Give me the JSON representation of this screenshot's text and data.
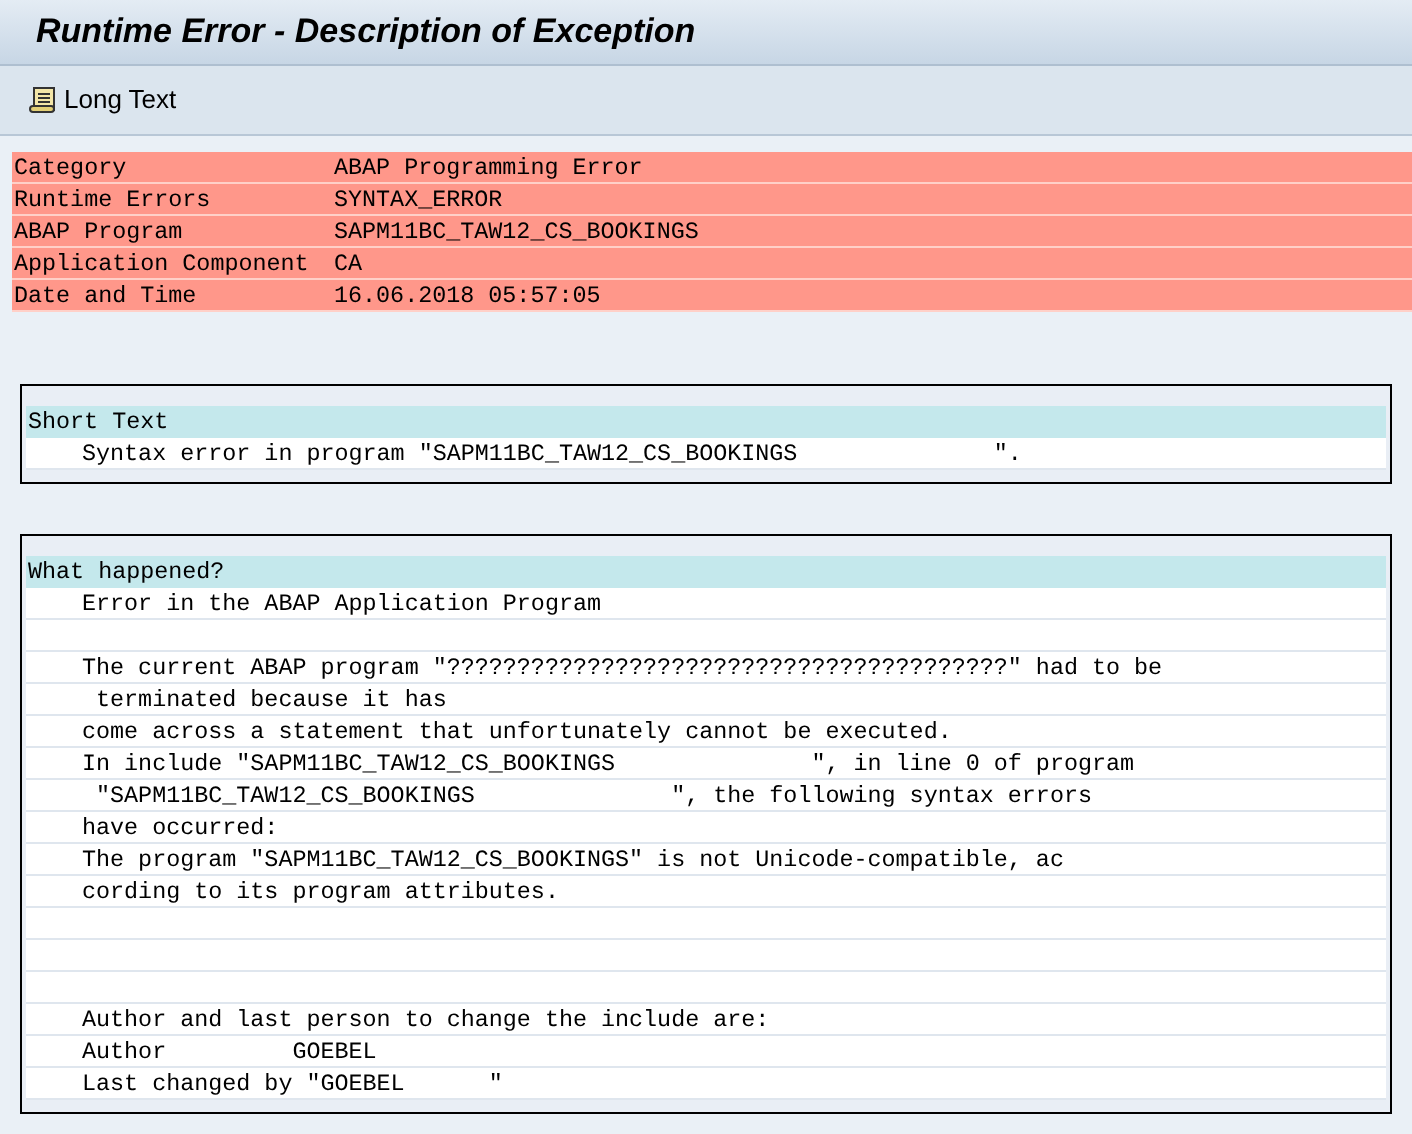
{
  "window": {
    "title": "Runtime Error - Description of Exception"
  },
  "toolbar": {
    "buttons": [
      {
        "label": "Long Text"
      }
    ]
  },
  "header_fields": [
    {
      "label": "Category",
      "value": "ABAP Programming Error"
    },
    {
      "label": "Runtime Errors",
      "value": "SYNTAX_ERROR"
    },
    {
      "label": "ABAP Program",
      "value": "SAPM11BC_TAW12_CS_BOOKINGS"
    },
    {
      "label": "Application Component",
      "value": "CA"
    },
    {
      "label": "Date and Time",
      "value": "16.06.2018 05:57:05"
    }
  ],
  "sections": [
    {
      "heading": "Short Text",
      "lines": [
        {
          "kind": "text",
          "text": "Syntax error in program \"SAPM11BC_TAW12_CS_BOOKINGS              \"."
        }
      ]
    },
    {
      "heading": "What happened?",
      "lines": [
        {
          "kind": "text",
          "text": "Error in the ABAP Application Program"
        },
        {
          "kind": "blank"
        },
        {
          "kind": "text",
          "text": "The current ABAP program \"????????????????????????????????????????\" had to be"
        },
        {
          "kind": "text",
          "text": " terminated because it has"
        },
        {
          "kind": "text",
          "text": "come across a statement that unfortunately cannot be executed."
        },
        {
          "kind": "text",
          "text": "In include \"SAPM11BC_TAW12_CS_BOOKINGS              \", in line 0 of program"
        },
        {
          "kind": "text",
          "text": " \"SAPM11BC_TAW12_CS_BOOKINGS              \", the following syntax errors"
        },
        {
          "kind": "text",
          "text": "have occurred:"
        },
        {
          "kind": "text",
          "text": "The program \"SAPM11BC_TAW12_CS_BOOKINGS\" is not Unicode-compatible, ac"
        },
        {
          "kind": "text",
          "text": "cording to its program attributes."
        },
        {
          "kind": "blank"
        },
        {
          "kind": "blank"
        },
        {
          "kind": "blank"
        },
        {
          "kind": "text",
          "text": "Author and last person to change the include are:"
        },
        {
          "kind": "text",
          "text": "Author         GOEBEL"
        },
        {
          "kind": "text",
          "text": "Last changed by \"GOEBEL      \""
        }
      ]
    }
  ]
}
